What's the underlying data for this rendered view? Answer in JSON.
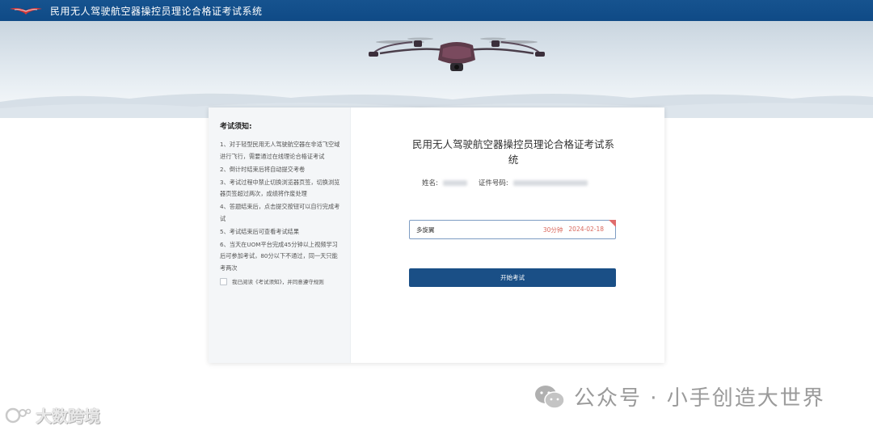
{
  "header": {
    "title": "民用无人驾驶航空器操控员理论合格证考试系统"
  },
  "notice": {
    "title": "考试须知:",
    "items": [
      "1、对于轻型民用无人驾驶航空器在非适飞空域进行飞行，需要通过在线理论合格证考试",
      "2、倒计时结束后将自动提交考卷",
      "3、考试过程中禁止切换浏览器页签，切换浏览器页签超过两次，成绩将作废处理",
      "4、答题结束后，点击提交按钮可以自行完成考试",
      "5、考试结束后可查看考试结果",
      "6、当天在UOM平台完成45分钟以上视频学习后可参加考试，80分以下不通过，同一天只能考两次"
    ],
    "agree_label": "我已阅读《考试须知》，并同意遵守规则"
  },
  "exam": {
    "title": "民用无人驾驶航空器操控员理论合格证考试系统",
    "name_label": "姓名:",
    "id_label": "证件号码:",
    "subject": {
      "name": "多旋翼",
      "duration": "30分钟",
      "date": "2024-02-18"
    },
    "start_button": "开始考试"
  },
  "watermarks": {
    "left": "大数跨境",
    "right": "公众号 · 小手创造大世界"
  },
  "colors": {
    "header_bg": "#0f4a86",
    "button_bg": "#1a4f86",
    "accent_red": "#d9675c"
  }
}
